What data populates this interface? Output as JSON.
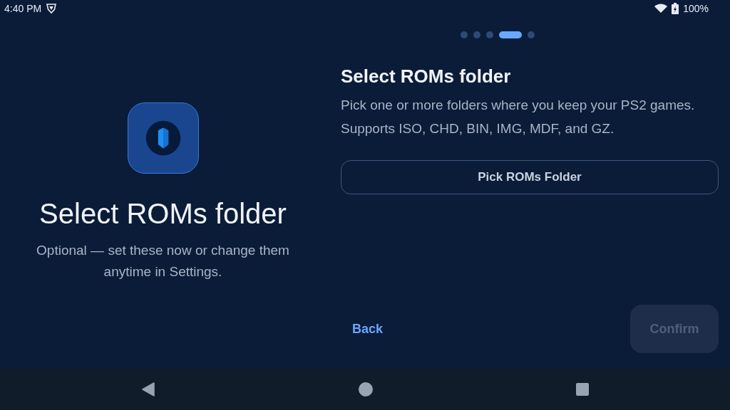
{
  "status_bar": {
    "time": "4:40 PM",
    "battery": "100%"
  },
  "intro": {
    "title": "Select ROMs folder",
    "subtitle": "Optional — set these now or change them anytime in Settings."
  },
  "pager": [
    {
      "selected": false
    },
    {
      "selected": false
    },
    {
      "selected": false
    },
    {
      "selected": true
    },
    {
      "selected": false
    }
  ],
  "step": {
    "title": "Select ROMs folder",
    "description": "Pick one or more folders where you keep your PS2 games. Supports ISO, CHD, BIN, IMG, MDF, and GZ.",
    "action": "Pick ROMs Folder"
  },
  "footer": {
    "back": "Back",
    "confirm": {
      "label": "Confirm",
      "disabled": true
    }
  }
}
